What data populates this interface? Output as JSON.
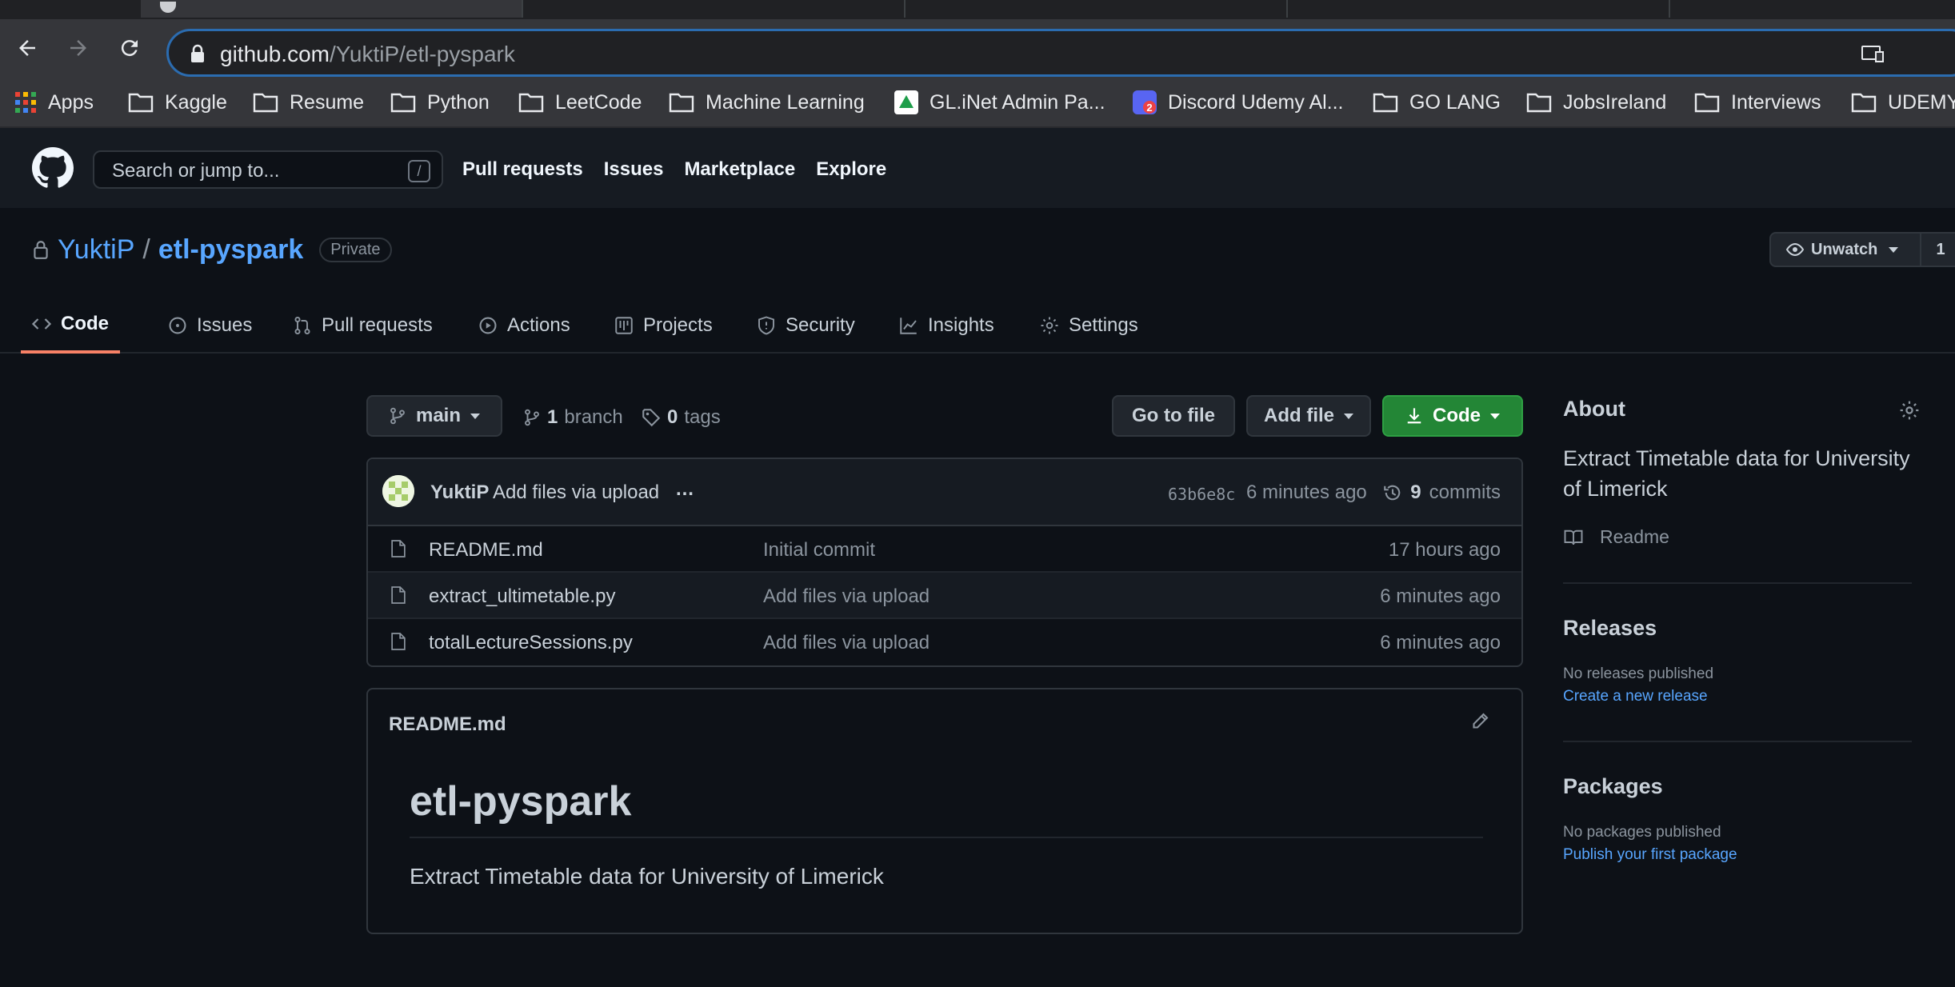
{
  "browser": {
    "url_host": "github.com",
    "url_path": "/YuktiP/etl-pyspark",
    "bookmarks": [
      {
        "label": "Apps",
        "icon": "apps-grid-icon"
      },
      {
        "label": "Kaggle",
        "icon": "folder-icon"
      },
      {
        "label": "Resume",
        "icon": "folder-icon"
      },
      {
        "label": "Python",
        "icon": "folder-icon"
      },
      {
        "label": "LeetCode",
        "icon": "folder-icon"
      },
      {
        "label": "Machine Learning",
        "icon": "folder-icon"
      },
      {
        "label": "GL.iNet Admin Pa...",
        "icon": "glinet-icon"
      },
      {
        "label": "Discord Udemy Al...",
        "icon": "discord-icon",
        "badge": "2"
      },
      {
        "label": "GO LANG",
        "icon": "folder-icon"
      },
      {
        "label": "JobsIreland",
        "icon": "folder-icon"
      },
      {
        "label": "Interviews",
        "icon": "folder-icon"
      },
      {
        "label": "UDEMY",
        "icon": "folder-icon"
      }
    ]
  },
  "header": {
    "search_placeholder": "Search or jump to...",
    "search_shortcut": "/",
    "nav": [
      "Pull requests",
      "Issues",
      "Marketplace",
      "Explore"
    ]
  },
  "repo": {
    "owner": "YuktiP",
    "separator": "/",
    "name": "etl-pyspark",
    "visibility": "Private",
    "watch_label": "Unwatch",
    "watch_count": "1"
  },
  "tabs": [
    {
      "label": "Code",
      "icon": "code-icon",
      "active": true
    },
    {
      "label": "Issues",
      "icon": "issue-icon"
    },
    {
      "label": "Pull requests",
      "icon": "pull-request-icon"
    },
    {
      "label": "Actions",
      "icon": "play-icon"
    },
    {
      "label": "Projects",
      "icon": "project-icon"
    },
    {
      "label": "Security",
      "icon": "shield-icon"
    },
    {
      "label": "Insights",
      "icon": "graph-icon"
    },
    {
      "label": "Settings",
      "icon": "gear-icon"
    }
  ],
  "toolbar": {
    "branch": "main",
    "branch_count": "1",
    "branch_word": "branch",
    "tag_count": "0",
    "tag_word": "tags",
    "go_to_file": "Go to file",
    "add_file": "Add file",
    "code": "Code"
  },
  "latest_commit": {
    "author": "YuktiP",
    "message": "Add files via upload",
    "ellipsis": "…",
    "hash": "63b6e8c",
    "time": "6 minutes ago",
    "commit_count": "9",
    "commit_word": "commits"
  },
  "files": [
    {
      "name": "README.md",
      "message": "Initial commit",
      "age": "17 hours ago"
    },
    {
      "name": "extract_ultimetable.py",
      "message": "Add files via upload",
      "age": "6 minutes ago"
    },
    {
      "name": "totalLectureSessions.py",
      "message": "Add files via upload",
      "age": "6 minutes ago"
    }
  ],
  "readme": {
    "filename": "README.md",
    "heading": "etl-pyspark",
    "body": "Extract Timetable data for University of Limerick"
  },
  "sidebar": {
    "about_title": "About",
    "about_desc": "Extract Timetable data for University of Limerick",
    "readme_link": "Readme",
    "releases_title": "Releases",
    "releases_text": "No releases published",
    "releases_link": "Create a new release",
    "packages_title": "Packages",
    "packages_text": "No packages published",
    "packages_link": "Publish your first package"
  },
  "colors": {
    "bg": "#0d1117",
    "header_bg": "#161b22",
    "link": "#58a6ff",
    "green_button": "#238636",
    "active_tab_underline": "#f78166"
  }
}
